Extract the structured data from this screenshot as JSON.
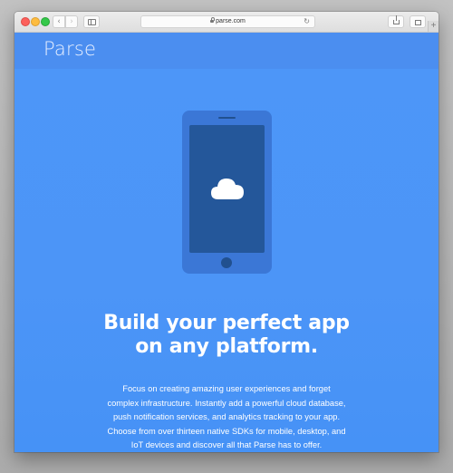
{
  "browser": {
    "url": "parse.com",
    "icons": {
      "back": "chevron-left-icon",
      "forward": "chevron-right-icon",
      "sidebar": "sidebar-icon",
      "lock": "lock-icon",
      "reload": "reload-icon",
      "share": "share-icon",
      "tabs": "tabs-icon",
      "new_tab": "plus-icon"
    },
    "colors": {
      "close": "#fc605c",
      "minimize": "#fdbc40",
      "maximize": "#34c84a"
    }
  },
  "site": {
    "logo": "Parse",
    "hero_illustration": "phone-with-cloud",
    "headline_line1": "Build your perfect app",
    "headline_line2": "on any platform.",
    "description_lines": [
      "Focus on creating amazing user experiences and forget",
      "complex infrastructure. Instantly add a powerful cloud database,",
      "push notification services, and analytics tracking to your app.",
      "Choose from over thirteen native SDKs for mobile, desktop, and",
      "IoT devices and discover all that Parse has to offer."
    ],
    "colors": {
      "background": "#4c95f7",
      "header": "#4b8ef0",
      "phone_body": "#3b77d6",
      "phone_screen": "#24579a"
    }
  }
}
